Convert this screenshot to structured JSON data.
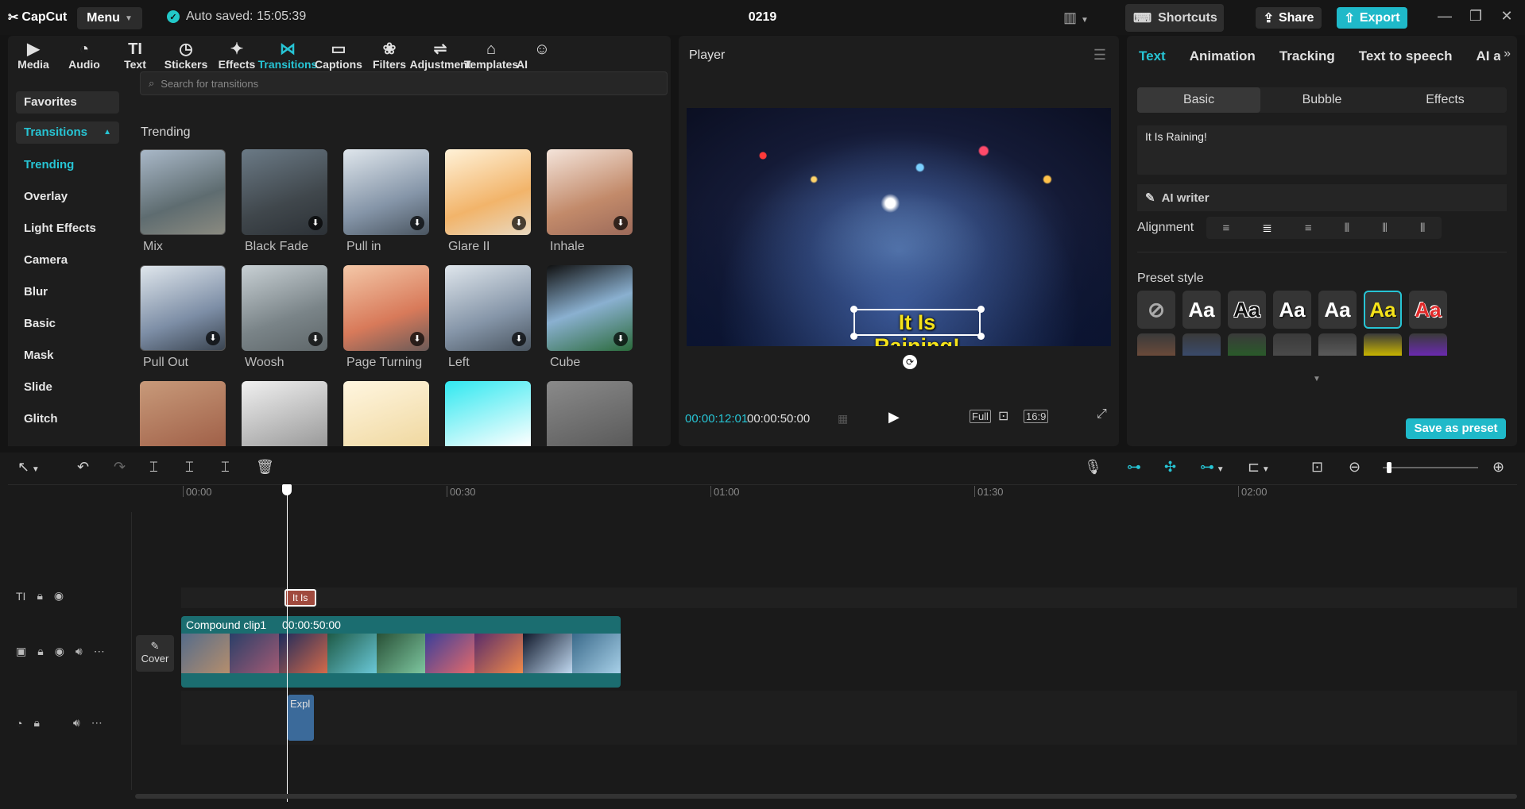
{
  "app": {
    "logo": "CapCut",
    "menu": "Menu",
    "autosave": "Auto saved: 15:05:39",
    "project_title": "0219"
  },
  "top_actions": {
    "shortcuts": "Shortcuts",
    "share": "Share",
    "export": "Export"
  },
  "toolbar": [
    {
      "label": "Media",
      "icon": "media-icon",
      "glyph": "▶"
    },
    {
      "label": "Audio",
      "icon": "audio-icon",
      "glyph": "◔"
    },
    {
      "label": "Text",
      "icon": "text-icon",
      "glyph": "TI"
    },
    {
      "label": "Stickers",
      "icon": "stickers-icon",
      "glyph": "◷"
    },
    {
      "label": "Effects",
      "icon": "effects-icon",
      "glyph": "✦"
    },
    {
      "label": "Transitions",
      "icon": "transitions-icon",
      "glyph": "⋈"
    },
    {
      "label": "Captions",
      "icon": "captions-icon",
      "glyph": "▭"
    },
    {
      "label": "Filters",
      "icon": "filters-icon",
      "glyph": "❀"
    },
    {
      "label": "Adjustment",
      "icon": "adjustment-icon",
      "glyph": "⇌"
    },
    {
      "label": "Templates",
      "icon": "templates-icon",
      "glyph": "⌂"
    },
    {
      "label": "AI avatars",
      "icon": "ai-avatars-icon",
      "glyph": "☺"
    }
  ],
  "sidebar": {
    "favorites": "Favorites",
    "transitions": "Transitions",
    "items": [
      "Trending",
      "Overlay",
      "Light Effects",
      "Camera",
      "Blur",
      "Basic",
      "Mask",
      "Slide",
      "Glitch"
    ]
  },
  "search": {
    "placeholder": "Search for transitions"
  },
  "section_title": "Trending",
  "transitions": [
    {
      "name": "Mix"
    },
    {
      "name": "Black Fade"
    },
    {
      "name": "Pull in"
    },
    {
      "name": "Glare II"
    },
    {
      "name": "Inhale"
    },
    {
      "name": "Pull Out"
    },
    {
      "name": "Woosh"
    },
    {
      "name": "Page Turning"
    },
    {
      "name": "Left"
    },
    {
      "name": "Cube"
    }
  ],
  "player": {
    "title": "Player",
    "caption": "It Is Raining!",
    "current_time": "00:00:12:01",
    "duration": "00:00:50:00",
    "full": "Full",
    "ratio": "16:9"
  },
  "right_panel": {
    "tabs": [
      "Text",
      "Animation",
      "Tracking",
      "Text to speech",
      "AI avatar"
    ],
    "subtabs": [
      "Basic",
      "Bubble",
      "Effects"
    ],
    "text_value": "It Is Raining!",
    "ai_writer": "AI writer",
    "alignment": "Alignment",
    "preset_style": "Preset style",
    "preset_sample": "Aa",
    "save_preset": "Save as preset"
  },
  "timeline": {
    "ruler": [
      "00:00",
      "00:30",
      "01:00",
      "01:30",
      "02:00"
    ],
    "text_clip": "It Is",
    "compound_clip": "Compound clip1",
    "compound_duration": "00:00:50:00",
    "cover": "Cover",
    "audio_clip": "Expl"
  }
}
